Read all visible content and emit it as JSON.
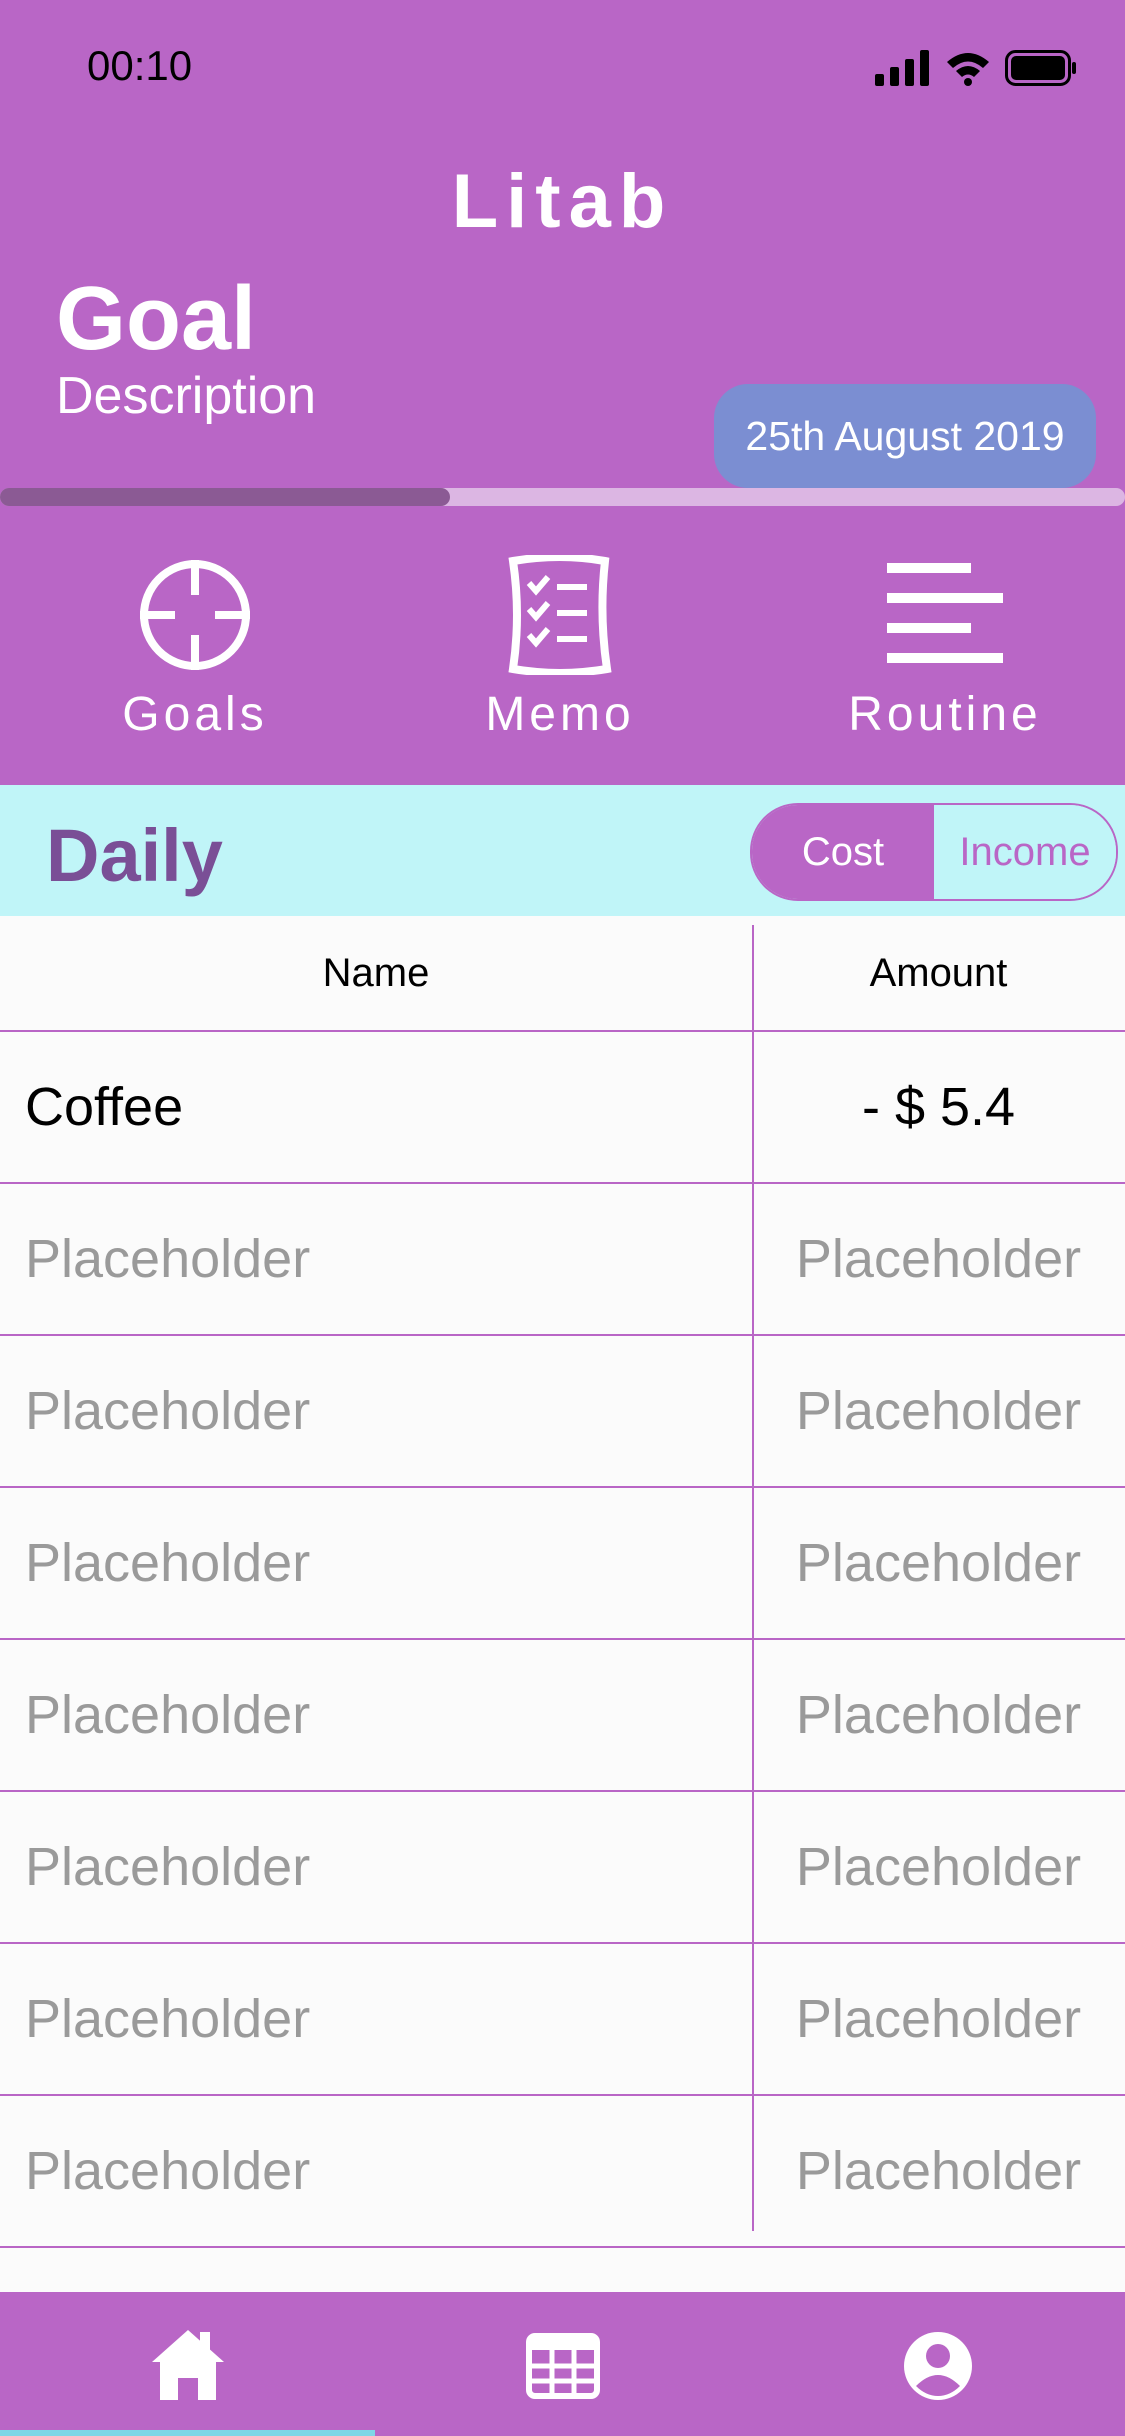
{
  "status": {
    "time": "00:10"
  },
  "app": {
    "title": "Litab"
  },
  "goal": {
    "title": "Goal",
    "description": "Description",
    "date": "25th August 2019",
    "progress_fraction": 0.4
  },
  "nav": [
    {
      "label": "Goals",
      "icon": "crosshair-icon"
    },
    {
      "label": "Memo",
      "icon": "checklist-icon"
    },
    {
      "label": "Routine",
      "icon": "lines-icon"
    }
  ],
  "daily": {
    "title": "Daily",
    "toggle": {
      "cost": "Cost",
      "income": "Income",
      "selected": "Cost"
    }
  },
  "table": {
    "headers": {
      "name": "Name",
      "amount": "Amount"
    },
    "rows": [
      {
        "name": "Coffee",
        "amount": "- $ 5.4"
      },
      {
        "name": "Placeholder",
        "amount": "Placeholder"
      },
      {
        "name": "Placeholder",
        "amount": "Placeholder"
      },
      {
        "name": "Placeholder",
        "amount": "Placeholder"
      },
      {
        "name": "Placeholder",
        "amount": "Placeholder"
      },
      {
        "name": "Placeholder",
        "amount": "Placeholder"
      },
      {
        "name": "Placeholder",
        "amount": "Placeholder"
      },
      {
        "name": "Placeholder",
        "amount": "Placeholder"
      }
    ]
  },
  "tabbar": {
    "items": [
      "home-icon",
      "calendar-icon",
      "profile-icon"
    ],
    "selected": "home-icon"
  },
  "colors": {
    "primary": "#b966c6",
    "accent_blue": "#7b8ed2",
    "daily_bg": "#c0f5f8",
    "daily_title": "#7a4f96"
  }
}
